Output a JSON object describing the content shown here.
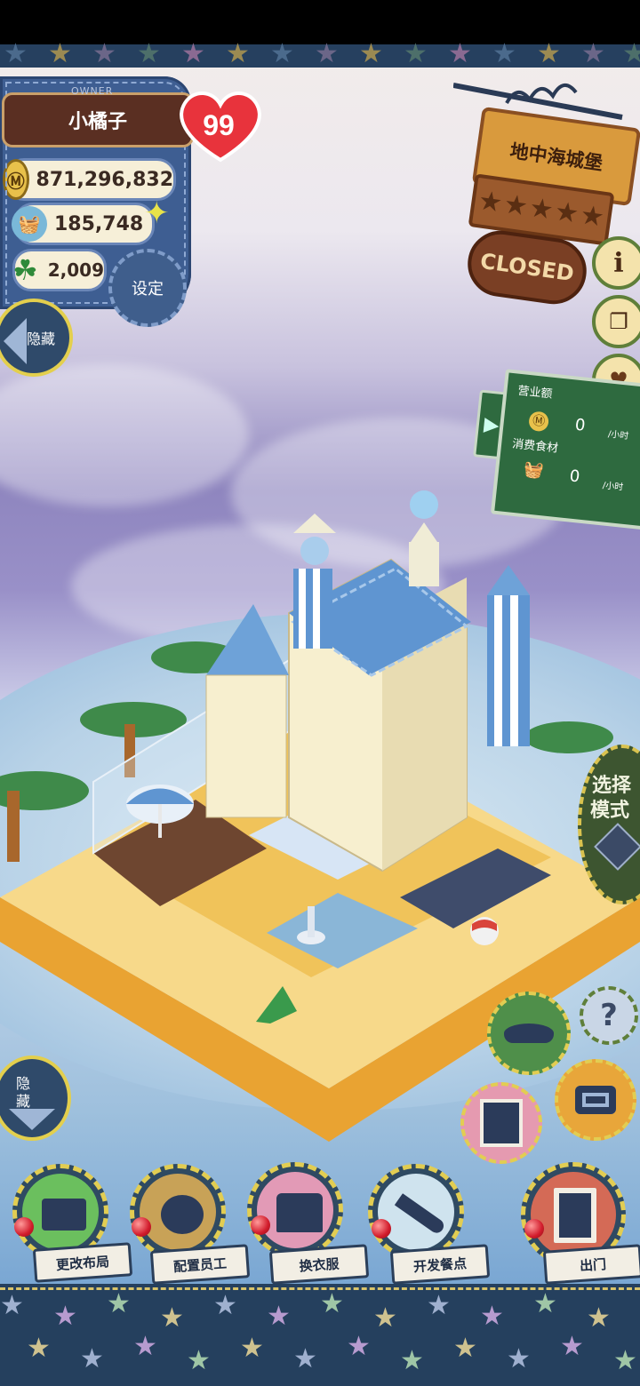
{
  "owner": {
    "label": "OWNER",
    "name": "小橘子",
    "level": "99",
    "money": "871,296,832",
    "ingredients": "185,748",
    "clover": "2,009",
    "settings_label": "设定",
    "hide_label": "隐藏"
  },
  "shop": {
    "name": "地中海城堡",
    "status": "CLOSED",
    "stars": [
      "★",
      "★",
      "★",
      "★",
      "★"
    ]
  },
  "side_icons": {
    "info": "i",
    "book": "book",
    "heart": "heart"
  },
  "sales": {
    "revenue_label": "营业额",
    "revenue_value": "0",
    "revenue_unit": "/小时",
    "consume_label": "消费食材",
    "consume_value": "0",
    "consume_unit": "/小时"
  },
  "mode_button": {
    "line1": "选择",
    "line2": "模式"
  },
  "hide_down_label": "隐藏",
  "bottom_menu": [
    {
      "label": "更改布局",
      "icon": "table-icon"
    },
    {
      "label": "配置员工",
      "icon": "bear-icon"
    },
    {
      "label": "换衣服",
      "icon": "shirt-icon"
    },
    {
      "label": "开发餐点",
      "icon": "knife-icon"
    },
    {
      "label": "出门",
      "icon": "door-icon"
    }
  ],
  "utility_buttons": {
    "help": "?",
    "camera": "camera",
    "hat": "hat",
    "gallery": "gallery"
  },
  "colors": {
    "denim": "#3e5e92",
    "stitch": "#e2cd52",
    "sign_wood": "#d99a3d",
    "board_green": "#2e6a3f",
    "heart_red": "#e8333c"
  }
}
